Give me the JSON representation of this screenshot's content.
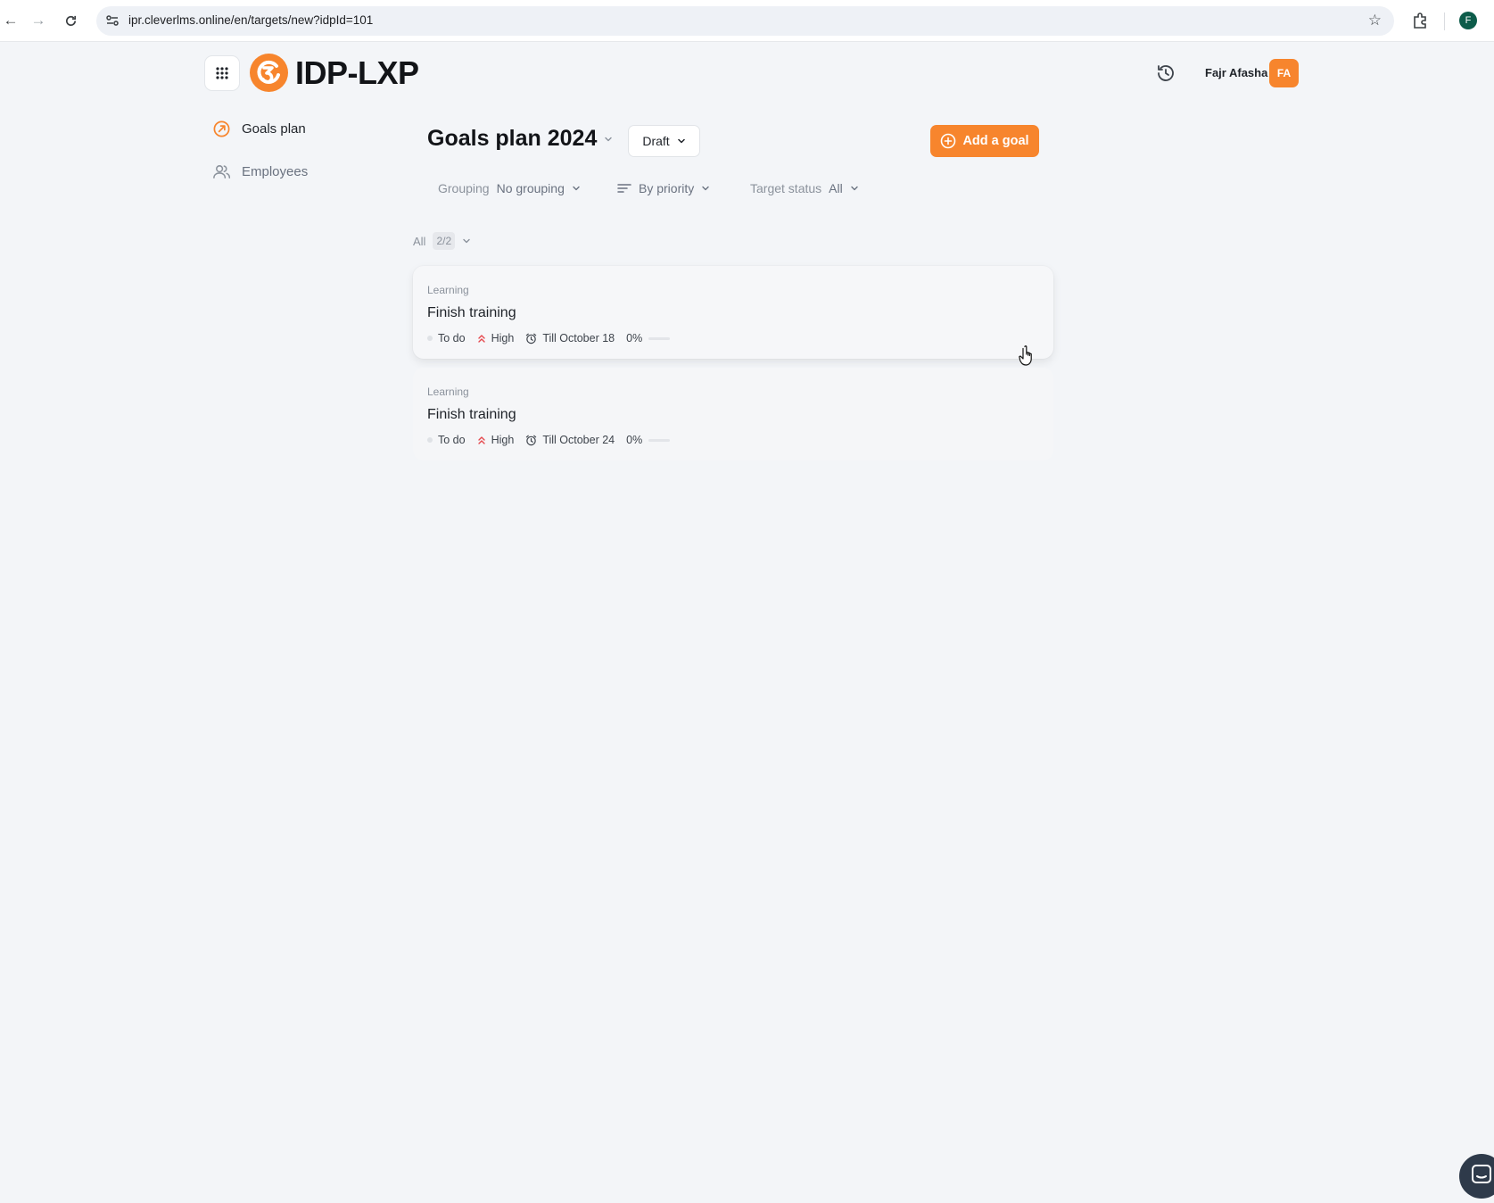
{
  "browser": {
    "url": "ipr.cleverlms.online/en/targets/new?idpId=101",
    "profile_initial": "F"
  },
  "header": {
    "brand": "IDP-LXP",
    "user_name": "Fajr Afasha",
    "user_initials": "FA"
  },
  "sidebar": {
    "items": [
      {
        "label": "Goals plan",
        "active": true
      },
      {
        "label": "Employees",
        "active": false
      }
    ]
  },
  "main": {
    "title": "Goals plan 2024",
    "status": "Draft",
    "add_button": "Add a goal",
    "filters": {
      "grouping_label": "Grouping",
      "grouping_value": "No grouping",
      "sort_value": "By priority",
      "target_status_label": "Target status",
      "target_status_value": "All"
    },
    "count": {
      "label": "All",
      "value": "2/2"
    },
    "goals": [
      {
        "category": "Learning",
        "title": "Finish training",
        "status": "To do",
        "priority": "High",
        "deadline": "Till October 18",
        "progress": "0%"
      },
      {
        "category": "Learning",
        "title": "Finish training",
        "status": "To do",
        "priority": "High",
        "deadline": "Till October 24",
        "progress": "0%"
      }
    ]
  },
  "colors": {
    "accent": "#f7852d",
    "background": "#f3f5f8",
    "priority_high": "#e5484d"
  }
}
